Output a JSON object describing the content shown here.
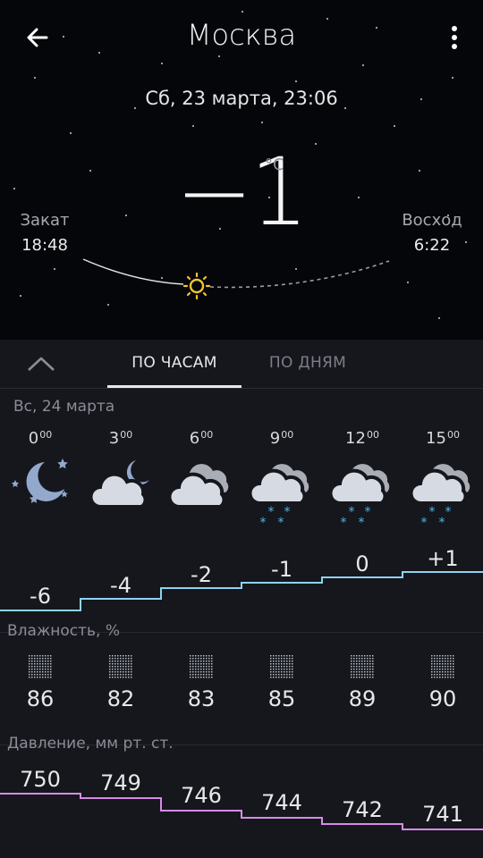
{
  "header": {
    "city": "Москва",
    "datetime": "Сб, 23 марта, 23:06",
    "temperature": "−1",
    "unit": "°C"
  },
  "sun": {
    "sunset_label": "Закат",
    "sunset_time": "18:48",
    "sunrise_label": "Восход",
    "sunrise_time": "6:22"
  },
  "tabs": {
    "hourly": "ПО ЧАСАМ",
    "daily": "ПО ДНЯМ"
  },
  "forecast": {
    "day_label": "Вс, 24 марта",
    "hours": [
      {
        "h": "0",
        "m": "00",
        "icon": "moon-stars-icon",
        "temp": "-6",
        "humidity": "86",
        "pressure": "750"
      },
      {
        "h": "3",
        "m": "00",
        "icon": "cloud-moon-icon",
        "temp": "-4",
        "humidity": "82",
        "pressure": "749"
      },
      {
        "h": "6",
        "m": "00",
        "icon": "cloud-icon",
        "temp": "-2",
        "humidity": "83",
        "pressure": "746"
      },
      {
        "h": "9",
        "m": "00",
        "icon": "cloud-snow-icon",
        "temp": "-1",
        "humidity": "85",
        "pressure": "744"
      },
      {
        "h": "12",
        "m": "00",
        "icon": "cloud-snow-icon",
        "temp": "0",
        "humidity": "89",
        "pressure": "742"
      },
      {
        "h": "15",
        "m": "00",
        "icon": "cloud-snow-icon",
        "temp": "+1",
        "humidity": "90",
        "pressure": "741"
      }
    ]
  },
  "humidity_section": {
    "label": "Влажность, %"
  },
  "pressure_section": {
    "label": "Давление, мм рт. ст."
  },
  "colors": {
    "temp_line": "#8fd3f0",
    "pressure_line": "#d68be6",
    "sun": "#f4c430"
  }
}
